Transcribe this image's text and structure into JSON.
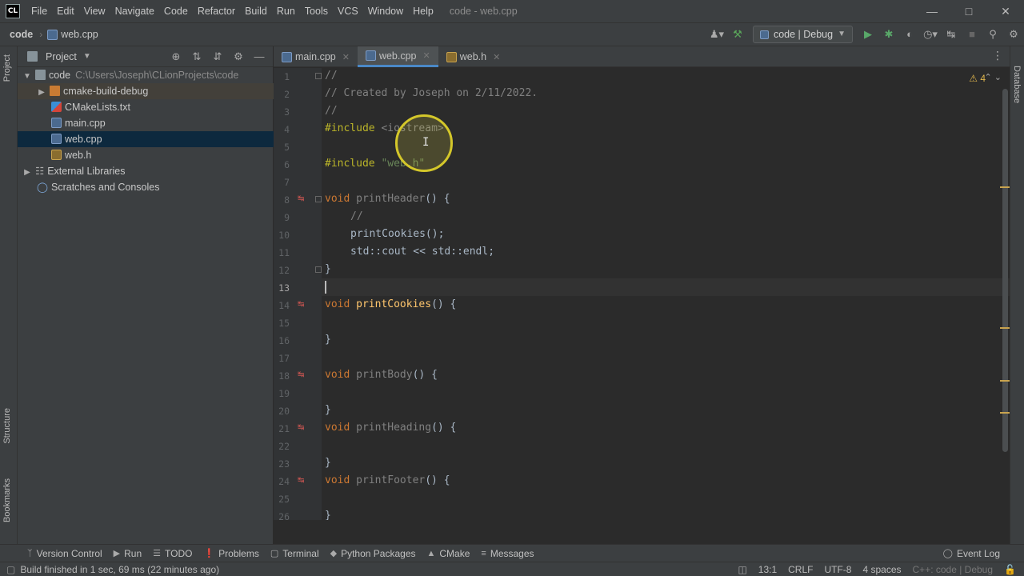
{
  "app": {
    "logo": "CL",
    "window_title": "code - web.cpp"
  },
  "menu": [
    "File",
    "Edit",
    "View",
    "Navigate",
    "Code",
    "Refactor",
    "Build",
    "Run",
    "Tools",
    "VCS",
    "Window",
    "Help"
  ],
  "nav": {
    "project": "code",
    "file": "web.cpp",
    "run_config": "code | Debug"
  },
  "project_panel": {
    "title": "Project",
    "tree": [
      {
        "label": "code",
        "path": "C:\\Users\\Joseph\\CLionProjects\\code",
        "type": "folder-root"
      },
      {
        "label": "cmake-build-debug",
        "type": "folder"
      },
      {
        "label": "CMakeLists.txt",
        "type": "cmake"
      },
      {
        "label": "main.cpp",
        "type": "cpp"
      },
      {
        "label": "web.cpp",
        "type": "cpp",
        "selected": true
      },
      {
        "label": "web.h",
        "type": "h"
      },
      {
        "label": "External Libraries",
        "type": "lib"
      },
      {
        "label": "Scratches and Consoles",
        "type": "scratch"
      }
    ]
  },
  "tabs": [
    {
      "label": "main.cpp",
      "type": "cpp"
    },
    {
      "label": "web.cpp",
      "type": "cpp",
      "active": true
    },
    {
      "label": "web.h",
      "type": "h"
    }
  ],
  "editor": {
    "warnings": "4",
    "line_numbers": [
      "1",
      "2",
      "3",
      "4",
      "5",
      "6",
      "7",
      "8",
      "9",
      "10",
      "11",
      "12",
      "13",
      "14",
      "15",
      "16",
      "17",
      "18",
      "19",
      "20",
      "21",
      "22",
      "23",
      "24",
      "25",
      "26"
    ],
    "code": {
      "l1": "//",
      "l2": "// Created by Joseph on 2/11/2022.",
      "l3": "//",
      "l4_kw": "#include",
      "l4_val": "<iostream>",
      "l6_kw": "#include",
      "l6_val": "\"web.h\"",
      "void": "void",
      "l8_fn": "printHeader",
      "l9": "//",
      "l10": "printCookies();",
      "l11a": "std::cout",
      "l11b": "<<",
      "l11c": "std::endl;",
      "l14_fn": "printCookies",
      "l18_fn": "printBody",
      "l21_fn": "printHeading",
      "l24_fn": "printFooter",
      "parens": "() {",
      "close": "}"
    }
  },
  "side_tabs": {
    "project": "Project",
    "structure": "Structure",
    "bookmarks": "Bookmarks",
    "database": "Database"
  },
  "tool_windows": [
    "Version Control",
    "Run",
    "TODO",
    "Problems",
    "Terminal",
    "Python Packages",
    "CMake",
    "Messages"
  ],
  "event_log": "Event Log",
  "status": {
    "message": "Build finished in 1 sec, 69 ms (22 minutes ago)",
    "position": "13:1",
    "line_sep": "CRLF",
    "encoding": "UTF-8",
    "indent": "4 spaces",
    "context": "C++: code | Debug"
  }
}
